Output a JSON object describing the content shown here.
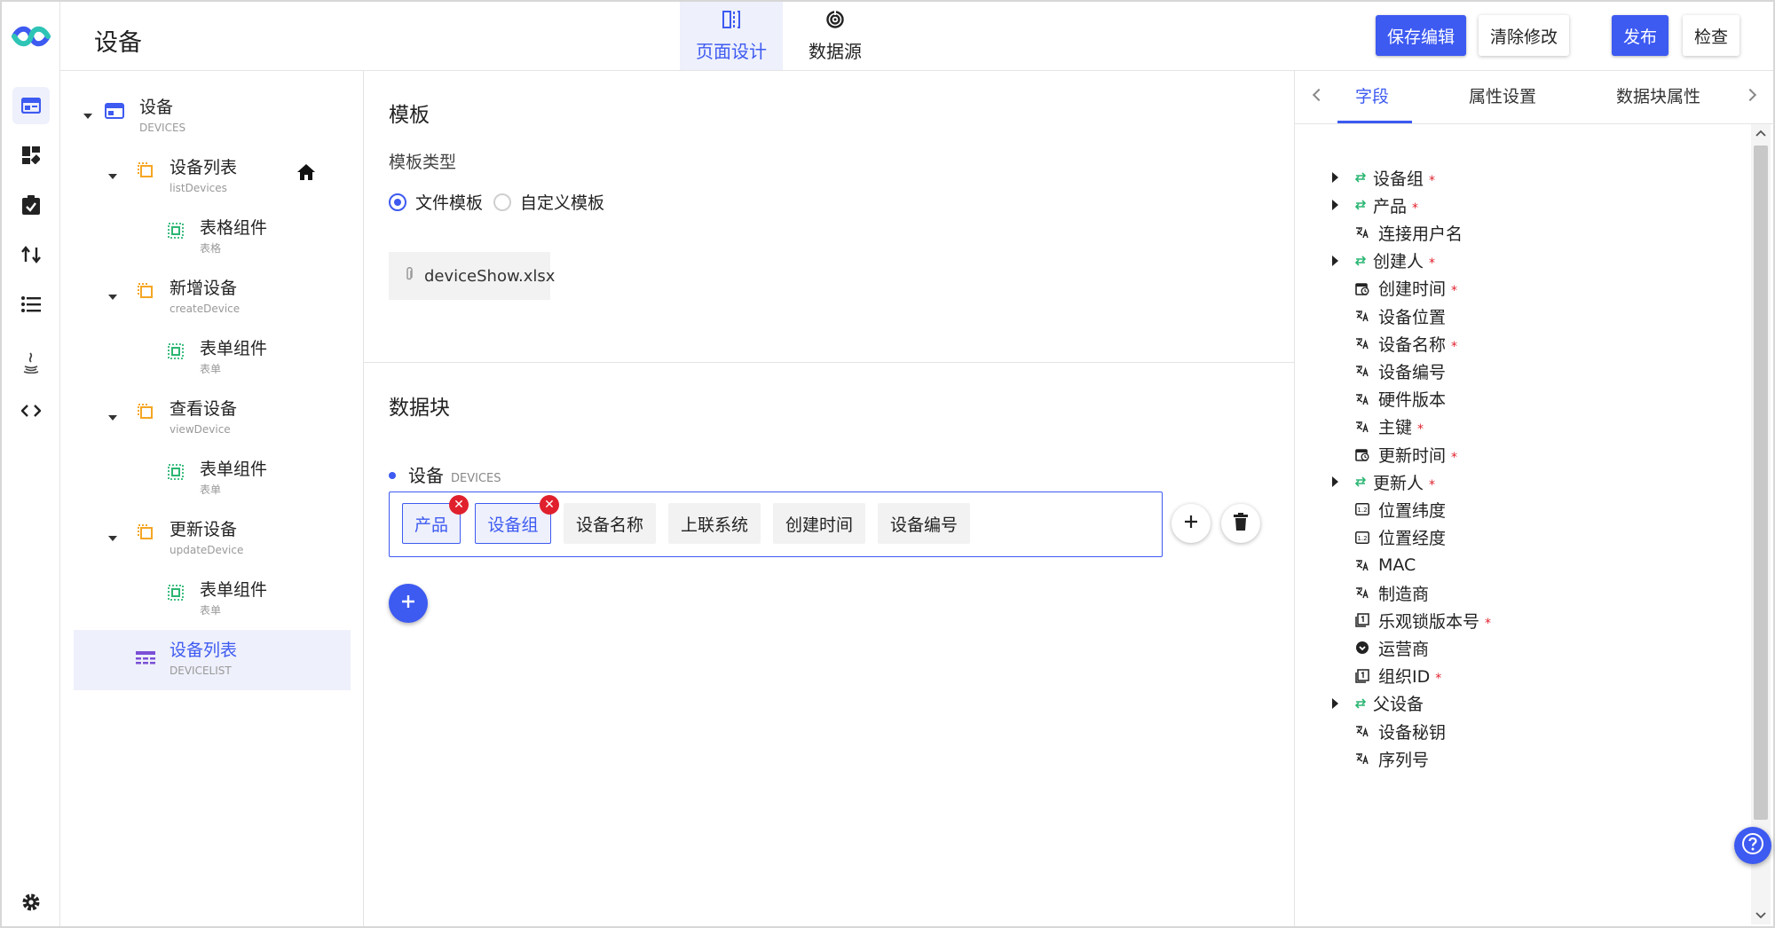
{
  "header": {
    "title": "设备",
    "tabs": [
      {
        "label": "页面设计",
        "icon": "page-design-icon",
        "active": true
      },
      {
        "label": "数据源",
        "icon": "datasource-icon",
        "active": false
      }
    ],
    "buttons": {
      "save": "保存编辑",
      "clear": "清除修改",
      "publish": "发布",
      "check": "检查"
    }
  },
  "rail": {
    "items": [
      "page-icon",
      "dashboard-icon",
      "task-icon",
      "flow-icon",
      "list-icon",
      "java-icon",
      "code-icon"
    ],
    "settings": "gear-icon"
  },
  "tree": {
    "root": {
      "label": "设备",
      "sub": "DEVICES"
    },
    "nodes": [
      {
        "label": "设备列表",
        "sub": "listDevices",
        "child": {
          "label": "表格组件",
          "sub": "表格"
        }
      },
      {
        "label": "新增设备",
        "sub": "createDevice",
        "child": {
          "label": "表单组件",
          "sub": "表单"
        }
      },
      {
        "label": "查看设备",
        "sub": "viewDevice",
        "child": {
          "label": "表单组件",
          "sub": "表单"
        }
      },
      {
        "label": "更新设备",
        "sub": "updateDevice",
        "child": {
          "label": "表单组件",
          "sub": "表单"
        }
      }
    ],
    "selected": {
      "label": "设备列表",
      "sub": "DEVICELIST"
    }
  },
  "template": {
    "title": "模板",
    "type_label": "模板类型",
    "options": [
      "文件模板",
      "自定义模板"
    ],
    "selected_option": "文件模板",
    "file": "deviceShow.xlsx"
  },
  "datablock": {
    "title": "数据块",
    "name": "设备",
    "name_sub": "DEVICES",
    "chips": [
      {
        "label": "产品",
        "picked": true
      },
      {
        "label": "设备组",
        "picked": true
      },
      {
        "label": "设备名称",
        "picked": false
      },
      {
        "label": "上联系统",
        "picked": false
      },
      {
        "label": "创建时间",
        "picked": false
      },
      {
        "label": "设备编号",
        "picked": false
      }
    ]
  },
  "right": {
    "tabs": [
      "字段",
      "属性设置",
      "数据块属性"
    ],
    "active_tab": "字段",
    "fields": [
      {
        "label": "设备组",
        "icon": "relation-icon",
        "required": true,
        "expandable": true
      },
      {
        "label": "产品",
        "icon": "relation-icon",
        "required": true,
        "expandable": true
      },
      {
        "label": "连接用户名",
        "icon": "text-icon",
        "required": false,
        "expandable": false
      },
      {
        "label": "创建人",
        "icon": "relation-icon",
        "required": true,
        "expandable": true
      },
      {
        "label": "创建时间",
        "icon": "datetime-icon",
        "required": true,
        "expandable": false
      },
      {
        "label": "设备位置",
        "icon": "text-icon",
        "required": false,
        "expandable": false
      },
      {
        "label": "设备名称",
        "icon": "text-icon",
        "required": true,
        "expandable": false
      },
      {
        "label": "设备编号",
        "icon": "text-icon",
        "required": false,
        "expandable": false
      },
      {
        "label": "硬件版本",
        "icon": "text-icon",
        "required": false,
        "expandable": false
      },
      {
        "label": "主键",
        "icon": "text-icon",
        "required": true,
        "expandable": false
      },
      {
        "label": "更新时间",
        "icon": "datetime-icon",
        "required": true,
        "expandable": false
      },
      {
        "label": "更新人",
        "icon": "relation-icon",
        "required": true,
        "expandable": true
      },
      {
        "label": "位置纬度",
        "icon": "decimal-icon",
        "required": false,
        "expandable": false
      },
      {
        "label": "位置经度",
        "icon": "decimal-icon",
        "required": false,
        "expandable": false
      },
      {
        "label": "MAC",
        "icon": "text-icon",
        "required": false,
        "expandable": false
      },
      {
        "label": "制造商",
        "icon": "text-icon",
        "required": false,
        "expandable": false
      },
      {
        "label": "乐观锁版本号",
        "icon": "integer-icon",
        "required": true,
        "expandable": false
      },
      {
        "label": "运营商",
        "icon": "enum-icon",
        "required": false,
        "expandable": false
      },
      {
        "label": "组织ID",
        "icon": "integer-icon",
        "required": true,
        "expandable": false
      },
      {
        "label": "父设备",
        "icon": "relation-icon",
        "required": false,
        "expandable": true
      },
      {
        "label": "设备秘钥",
        "icon": "text-icon",
        "required": false,
        "expandable": false
      },
      {
        "label": "序列号",
        "icon": "text-icon",
        "required": false,
        "expandable": false
      }
    ],
    "required_mark": "*"
  },
  "colors": {
    "accent": "#3d5af1",
    "accent_light": "#eef0fb",
    "required": "#e0202d",
    "node_orange": "#f5a623",
    "component_green": "#2bb673",
    "selected_purple": "#7b4fd6"
  }
}
